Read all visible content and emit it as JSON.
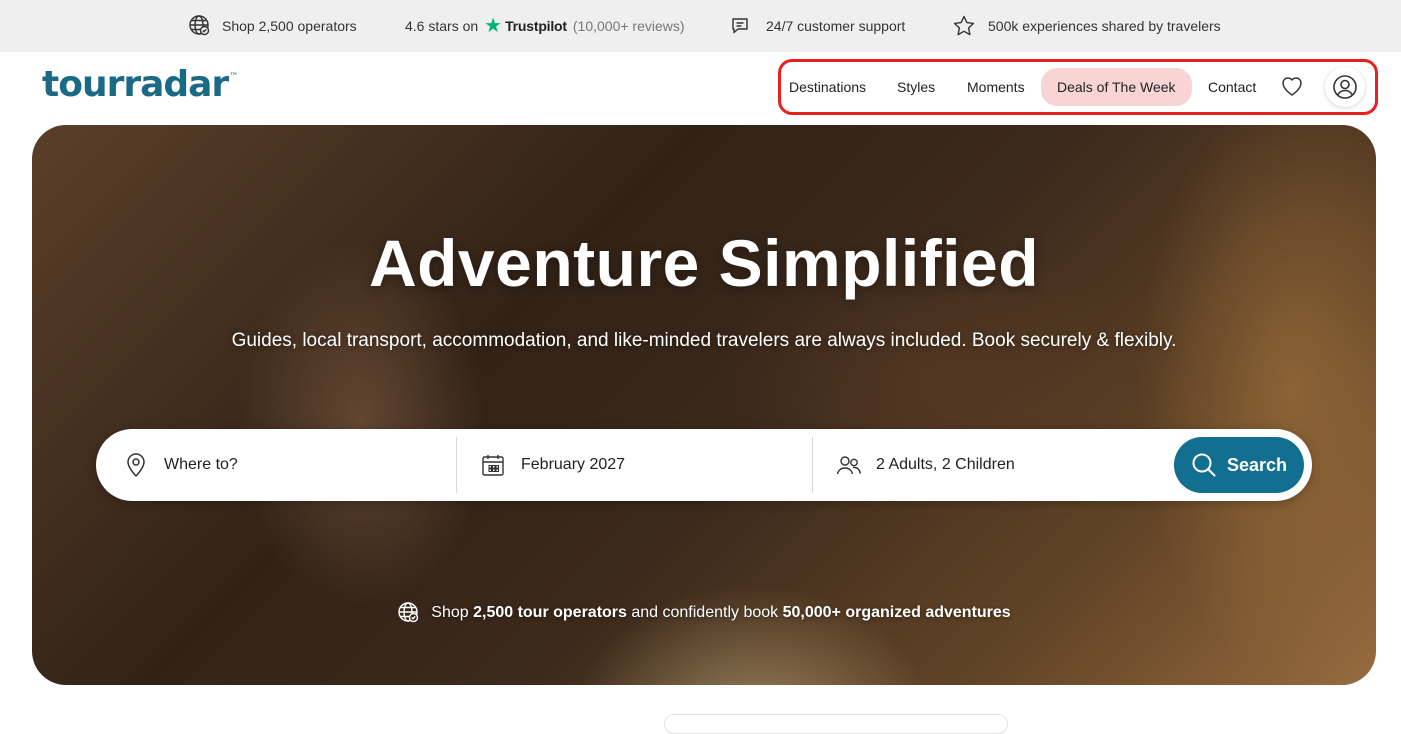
{
  "topbar": {
    "operators": "Shop 2,500 operators",
    "stars_prefix": "4.6 stars on",
    "trustpilot_name": "Trustpilot",
    "reviews": "(10,000+ reviews)",
    "support": "24/7 customer support",
    "experiences": "500k experiences shared by travelers"
  },
  "header": {
    "logo_text": "tourradar",
    "logo_tm": "™",
    "nav": {
      "destinations": "Destinations",
      "styles": "Styles",
      "moments": "Moments",
      "deals": "Deals of The Week",
      "contact": "Contact"
    }
  },
  "hero": {
    "title": "Adventure Simplified",
    "subtitle": "Guides, local transport, accommodation, and like-minded travelers are always included. Book securely & flexibly.",
    "search": {
      "where": "Where to?",
      "date": "February 2027",
      "travelers": "2 Adults, 2 Children",
      "button": "Search"
    },
    "footer": {
      "p1": "Shop ",
      "b1": "2,500 tour operators",
      "p2": " and confidently book ",
      "b2": "50,000+ organized adventures"
    }
  },
  "colors": {
    "brand": "#1a6a85",
    "search_button": "#136f8f",
    "deal_highlight": "#f9d4d4",
    "trustpilot_green": "#00b67a",
    "annotation_red": "#e82020"
  }
}
